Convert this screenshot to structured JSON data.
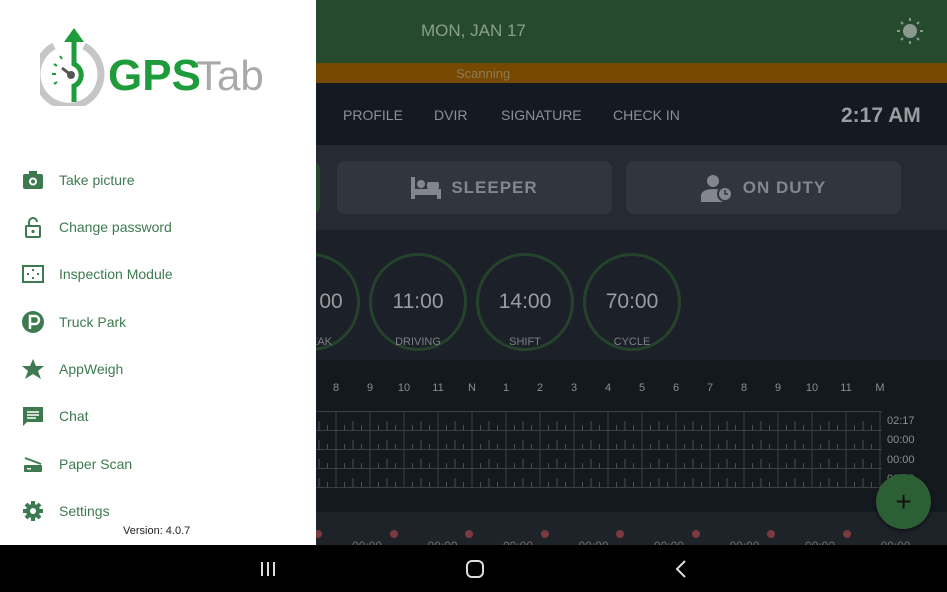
{
  "header": {
    "date": "MON, JAN 17",
    "theme_icon": "sun-icon",
    "status": "Scanning",
    "colors": {
      "header": "#264a2d",
      "status_bar": "#774800",
      "accent": "#3d7a4f"
    }
  },
  "tabs": [
    {
      "label": "PROFILE"
    },
    {
      "label": "DVIR"
    },
    {
      "label": "SIGNATURE"
    },
    {
      "label": "CHECK IN"
    }
  ],
  "clock": "2:17 AM",
  "duty_buttons": [
    {
      "label": "SLEEPER",
      "icon": "bed-icon"
    },
    {
      "label": "ON DUTY",
      "icon": "person-clock-icon"
    }
  ],
  "gauges": [
    {
      "value": "00",
      "label": "EAK"
    },
    {
      "value": "11:00",
      "label": "DRIVING"
    },
    {
      "value": "14:00",
      "label": "SHIFT"
    },
    {
      "value": "70:00",
      "label": "CYCLE"
    }
  ],
  "graph": {
    "hours": [
      "8",
      "9",
      "10",
      "11",
      "N",
      "1",
      "2",
      "3",
      "4",
      "5",
      "6",
      "7",
      "8",
      "9",
      "10",
      "11",
      "M"
    ],
    "row_totals": [
      "02:17",
      "00:00",
      "00:00",
      "00:00"
    ]
  },
  "bottom_values": [
    "00:00",
    "00:00",
    "00:00",
    "00:00",
    "00:00",
    "00:00",
    "00:00",
    "00:00"
  ],
  "fab": "+",
  "drawer": {
    "logo": "GPSTab",
    "items": [
      {
        "label": "Take picture",
        "icon": "camera-icon"
      },
      {
        "label": "Change password",
        "icon": "lock-open-icon"
      },
      {
        "label": "Inspection Module",
        "icon": "inspection-frame-icon"
      },
      {
        "label": "Truck Park",
        "icon": "parking-icon"
      },
      {
        "label": "AppWeigh",
        "icon": "appweigh-star-icon"
      },
      {
        "label": "Chat",
        "icon": "chat-icon"
      },
      {
        "label": "Paper Scan",
        "icon": "scanner-icon"
      },
      {
        "label": "Settings",
        "icon": "gear-icon"
      }
    ],
    "version": "Version: 4.0.7"
  },
  "navbar": {
    "recents": "recents-icon",
    "home": "home-icon",
    "back": "back-icon"
  }
}
